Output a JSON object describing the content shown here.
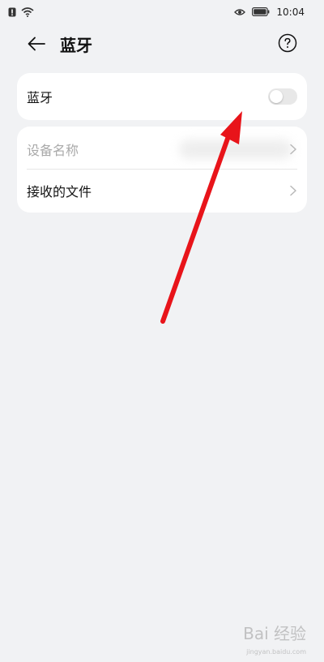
{
  "status_bar": {
    "time": "10:04",
    "icons": [
      "notification-icon",
      "wifi-icon",
      "eye-icon",
      "battery-icon"
    ]
  },
  "header": {
    "back_icon": "arrow-left-icon",
    "title": "蓝牙",
    "help_icon": "help-circle-icon"
  },
  "bluetooth_card": {
    "label": "蓝牙",
    "toggle_on": false
  },
  "list": {
    "items": [
      {
        "label": "设备名称",
        "enabled": false,
        "icon": "chevron-right-icon"
      },
      {
        "label": "接收的文件",
        "enabled": true,
        "icon": "chevron-right-icon"
      }
    ]
  },
  "annotation": {
    "arrow_color": "#e8141a"
  },
  "watermark": {
    "text": "Bai 经验",
    "sub": "jingyan.baidu.com"
  },
  "colors": {
    "background": "#f1f2f4",
    "card": "#ffffff",
    "toggle_off": "#e8e8e8",
    "disabled_text": "#a9a9a9"
  }
}
